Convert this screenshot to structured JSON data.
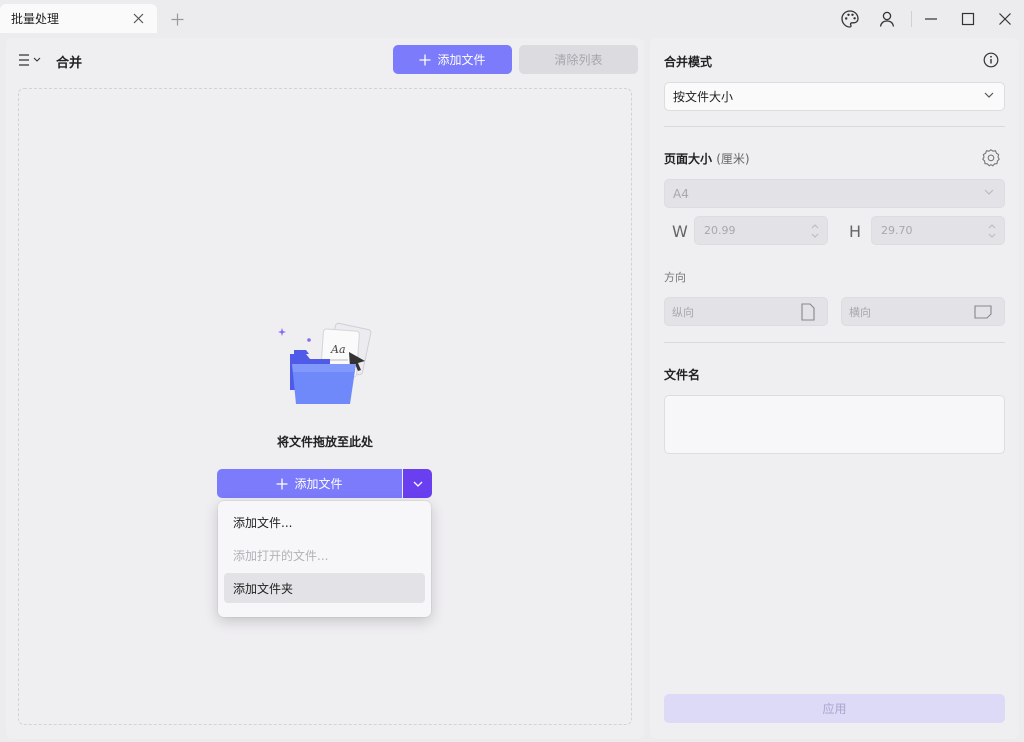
{
  "tab": {
    "title": "批量处理"
  },
  "left": {
    "title": "合并",
    "add_files_label": "添加文件",
    "clear_list_label": "清除列表",
    "drop_text": "将文件拖放至此处",
    "split_add_label": "添加文件",
    "dropdown_items": [
      {
        "label": "添加文件...",
        "enabled": true
      },
      {
        "label": "添加打开的文件...",
        "enabled": false
      },
      {
        "label": "添加文件夹",
        "enabled": true
      }
    ]
  },
  "right": {
    "merge_mode_label": "合并模式",
    "merge_mode_value": "按文件大小",
    "page_size_label": "页面大小",
    "page_size_unit": "(厘米)",
    "page_size_value": "A4",
    "width_letter": "W",
    "width_value": "20.99",
    "height_letter": "H",
    "height_value": "29.70",
    "orientation_label": "方向",
    "portrait_label": "纵向",
    "landscape_label": "横向",
    "filename_label": "文件名",
    "filename_value": "",
    "apply_label": "应用"
  },
  "colors": {
    "accent": "#7b7bfc",
    "accent_dark": "#6a3ff0",
    "disabled_apply": "#dcdaf6"
  }
}
